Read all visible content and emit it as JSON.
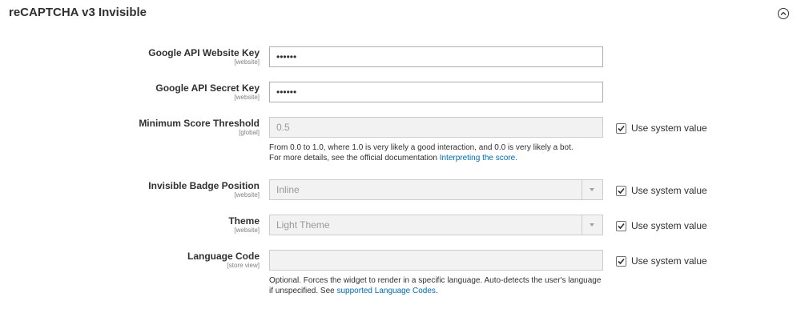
{
  "section": {
    "title": "reCAPTCHA v3 Invisible"
  },
  "fields": [
    {
      "label": "Google API Website Key",
      "scope": "[website]",
      "value": "••••••"
    },
    {
      "label": "Google API Secret Key",
      "scope": "[website]",
      "value": "••••••"
    },
    {
      "label": "Minimum Score Threshold",
      "scope": "[global]",
      "value": "0.5",
      "use_system": "Use system value",
      "note_line1": "From 0.0 to 1.0, where 1.0 is very likely a good interaction, and 0.0 is very likely a bot.",
      "note_line2": "For more details, see the official documentation",
      "note_link": "Interpreting the score."
    },
    {
      "label": "Invisible Badge Position",
      "scope": "[website]",
      "value": "Inline",
      "use_system": "Use system value"
    },
    {
      "label": "Theme",
      "scope": "[website]",
      "value": "Light Theme",
      "use_system": "Use system value"
    },
    {
      "label": "Language Code",
      "scope": "[store view]",
      "value": "",
      "use_system": "Use system value",
      "note_line1": "Optional. Forces the widget to render in a specific language. Auto-detects the user's language",
      "note_line2": "if unspecified. See",
      "note_link": "supported Language Codes",
      "note_end": "."
    }
  ],
  "icons": {
    "toggle": "chevron-up-icon",
    "check": "checkmark-icon",
    "dropdown": "caret-down-icon"
  }
}
